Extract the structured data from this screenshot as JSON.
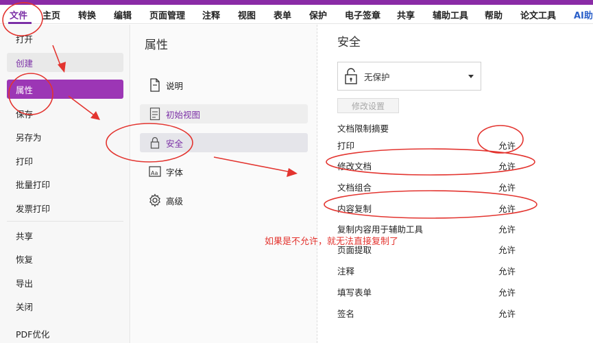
{
  "menubar": {
    "items": [
      "文件",
      "主页",
      "转换",
      "编辑",
      "页面管理",
      "注释",
      "视图",
      "表单",
      "保护",
      "电子签章",
      "共享",
      "辅助工具",
      "帮助",
      "论文工具",
      "AI助手"
    ]
  },
  "sidebar": {
    "items": [
      "打开",
      "创建",
      "属性",
      "保存",
      "另存为",
      "打印",
      "批量打印",
      "发票打印",
      "共享",
      "恢复",
      "导出",
      "关闭",
      "PDF优化"
    ]
  },
  "properties": {
    "title": "属性",
    "items": [
      "说明",
      "初始视图",
      "安全",
      "字体",
      "高级"
    ]
  },
  "security": {
    "title": "安全",
    "dropdown_value": "无保护",
    "modify_button": "修改设置",
    "summary_title": "文档限制摘要",
    "permissions": [
      {
        "name": "打印",
        "value": "允许"
      },
      {
        "name": "修改文档",
        "value": "允许"
      },
      {
        "name": "文档组合",
        "value": "允许"
      },
      {
        "name": "内容复制",
        "value": "允许"
      },
      {
        "name": "复制内容用于辅助工具",
        "value": "允许"
      },
      {
        "name": "页面提取",
        "value": "允许"
      },
      {
        "name": "注释",
        "value": "允许"
      },
      {
        "name": "填写表单",
        "value": "允许"
      },
      {
        "name": "签名",
        "value": "允许"
      }
    ]
  },
  "annotation": {
    "note": "如果是不允许，就无法直接复制了"
  },
  "colors": {
    "accent": "#9c36b5",
    "annotation": "#e3342f"
  }
}
